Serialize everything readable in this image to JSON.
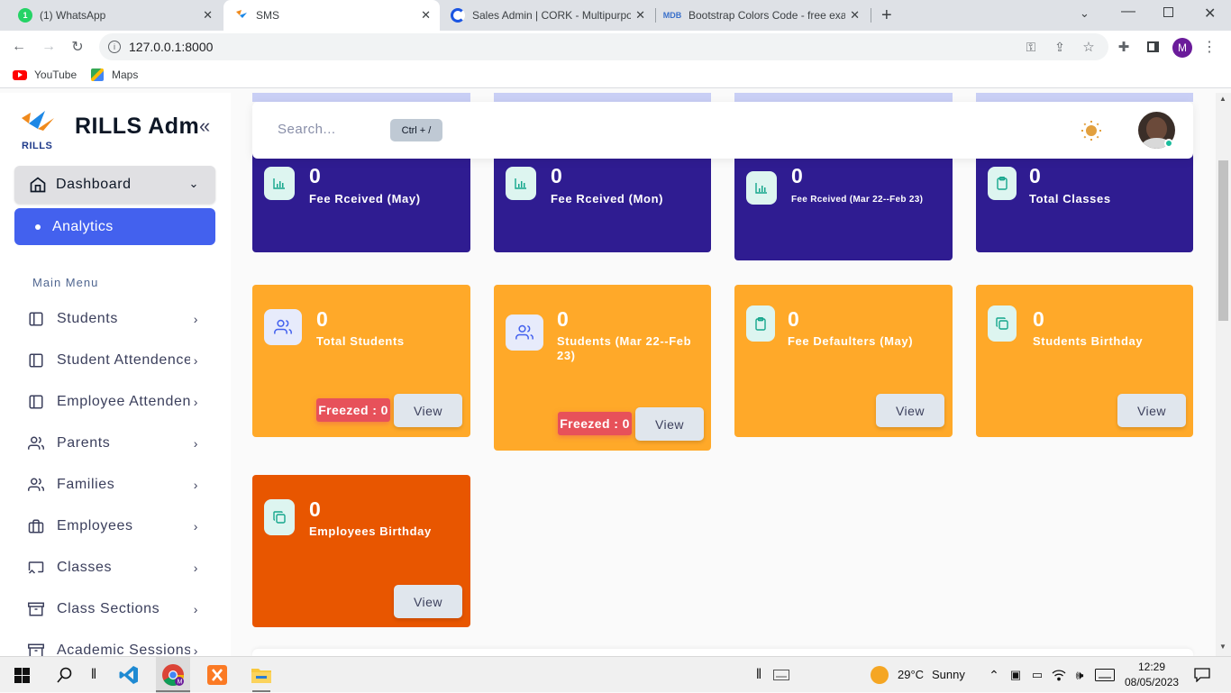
{
  "browser": {
    "tabs": [
      {
        "title": "(1) WhatsApp",
        "favicon": "whatsapp-icon"
      },
      {
        "title": "SMS",
        "favicon": "rills-icon"
      },
      {
        "title": "Sales Admin | CORK - Multipurpo",
        "favicon": "cork-icon"
      },
      {
        "title": "Bootstrap Colors Code - free exa",
        "favicon": "mdb-icon"
      }
    ],
    "url": "127.0.0.1:8000",
    "bookmarks": [
      "YouTube",
      "Maps"
    ],
    "profile_initial": "M"
  },
  "sidebar": {
    "brand": "RILLS Adm",
    "logo_text": "RILLS",
    "dashboard_label": "Dashboard",
    "analytics_label": "Analytics",
    "menu_heading": "Main Menu",
    "items": [
      {
        "label": "Students",
        "icon": "book-icon"
      },
      {
        "label": "Student Attendence",
        "icon": "book-icon"
      },
      {
        "label": "Employee Attendence",
        "icon": "book-icon"
      },
      {
        "label": "Parents",
        "icon": "users-icon"
      },
      {
        "label": "Families",
        "icon": "users-icon"
      },
      {
        "label": "Employees",
        "icon": "briefcase-icon"
      },
      {
        "label": "Classes",
        "icon": "cast-icon"
      },
      {
        "label": "Class Sections",
        "icon": "archive-icon"
      },
      {
        "label": "Academic Sessions",
        "icon": "archive-icon"
      }
    ]
  },
  "header": {
    "search_placeholder": "Search...",
    "shortcut": "Ctrl + /"
  },
  "cards": [
    {
      "value": "0",
      "label": "Fee Rceived (May)",
      "icon": "bar-chart-icon"
    },
    {
      "value": "0",
      "label": "Fee Rceived (Mon)",
      "icon": "bar-chart-icon"
    },
    {
      "value": "0",
      "label": "Fee Rceived (Mar 22--Feb 23)",
      "icon": "bar-chart-icon"
    },
    {
      "value": "0",
      "label": "Total Classes",
      "icon": "clipboard-icon"
    },
    {
      "value": "0",
      "label": "Total Students",
      "icon": "users-icon",
      "freeze": "Freezed : 0",
      "view": "View"
    },
    {
      "value": "0",
      "label": "Students (Mar 22--Feb 23)",
      "icon": "users-icon",
      "freeze": "Freezed : 0",
      "view": "View"
    },
    {
      "value": "0",
      "label": "Fee Defaulters (May)",
      "icon": "clipboard-icon",
      "view": "View"
    },
    {
      "value": "0",
      "label": "Students Birthday",
      "icon": "copy-icon",
      "view": "View"
    },
    {
      "value": "0",
      "label": "Employees Birthday",
      "icon": "copy-icon",
      "view": "View"
    }
  ],
  "colors": {
    "navy": "#2f1c91",
    "amber": "#ffa929",
    "orange": "#e85600",
    "primary": "#4361ee",
    "danger": "#e7515a"
  },
  "taskbar": {
    "weather_temp": "29°C",
    "weather_text": "Sunny",
    "time": "12:29",
    "date": "08/05/2023"
  }
}
